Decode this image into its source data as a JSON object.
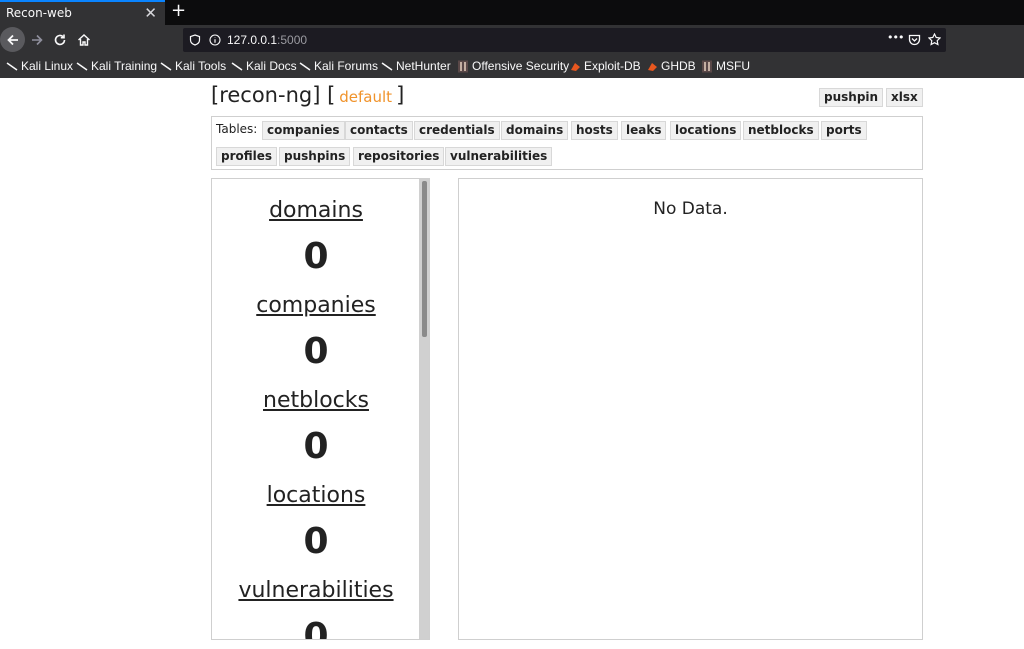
{
  "browser": {
    "tab_title": "Recon-web",
    "tab_close": "✕",
    "new_tab": "+",
    "url_host": "127.0.0.1",
    "url_port": ":5000",
    "menu_dots": "•••",
    "bookmarks": [
      "Kali Linux",
      "Kali Training",
      "Kali Tools",
      "Kali Docs",
      "Kali Forums",
      "NetHunter",
      "Offensive Security",
      "Exploit-DB",
      "GHDB",
      "MSFU"
    ]
  },
  "header": {
    "brand_open": "[recon-ng] [",
    "workspace": "default",
    "brand_close": "]",
    "pushpin_label": "pushpin",
    "xlsx_label": "xlsx"
  },
  "tables": {
    "label": "Tables:",
    "items": [
      "companies",
      "contacts",
      "credentials",
      "domains",
      "hosts",
      "leaks",
      "locations",
      "netblocks",
      "ports",
      "profiles",
      "pushpins",
      "repositories",
      "vulnerabilities"
    ]
  },
  "summary": [
    {
      "name": "domains",
      "count": "0"
    },
    {
      "name": "companies",
      "count": "0"
    },
    {
      "name": "netblocks",
      "count": "0"
    },
    {
      "name": "locations",
      "count": "0"
    },
    {
      "name": "vulnerabilities",
      "count": "0"
    }
  ],
  "main": {
    "message": "No Data."
  },
  "colors": {
    "accent": "#0a84ff",
    "workspace": "#f0932b",
    "chrome": "#323234"
  }
}
